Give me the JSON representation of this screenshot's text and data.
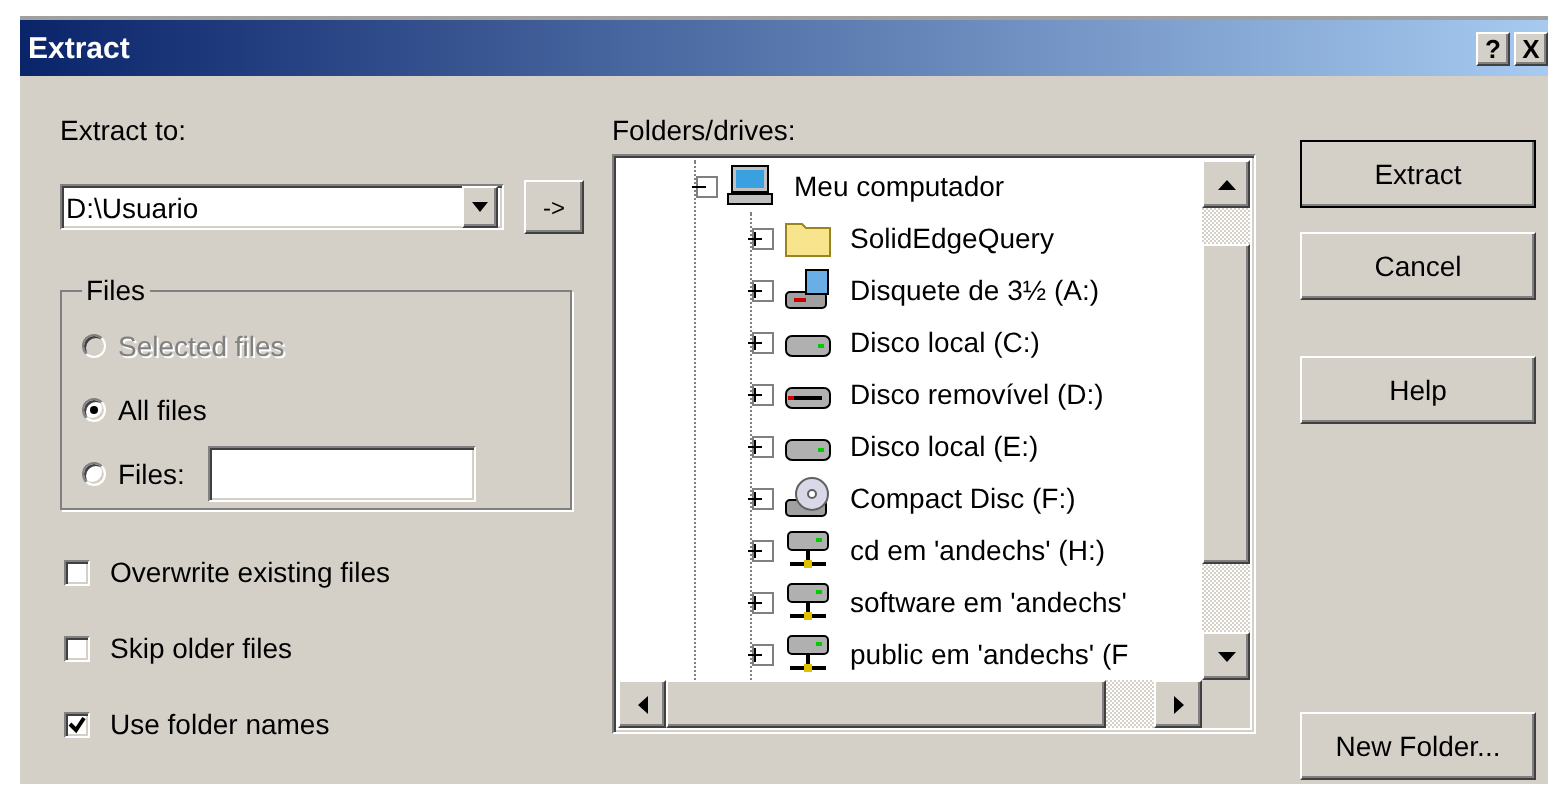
{
  "window": {
    "title": "Extract",
    "title_buttons": [
      "?",
      "X"
    ]
  },
  "extract_to": {
    "label": "Extract to:",
    "value": "D:\\Usuario",
    "arrow_button": "->"
  },
  "files_group": {
    "title": "Files",
    "options": [
      {
        "kind": "radio",
        "label": "Selected files",
        "selected": false,
        "disabled": true
      },
      {
        "kind": "radio",
        "label": "All files",
        "selected": true,
        "disabled": false
      },
      {
        "kind": "radio-field",
        "label": "Files:",
        "selected": false,
        "disabled": false
      }
    ]
  },
  "checkboxes": [
    {
      "label": "Overwrite existing files",
      "checked": false
    },
    {
      "label": "Skip older files",
      "checked": false
    },
    {
      "label": "Use folder names",
      "checked": true
    }
  ],
  "folders": {
    "label": "Folders/drives:",
    "tree": [
      {
        "kind": "computer",
        "label": "Meu computador",
        "expanded": true,
        "children": [
          {
            "kind": "folder",
            "label": "SolidEdgeQuery",
            "expanded": false
          },
          {
            "kind": "floppy",
            "label": "Disquete de 3½ (A:)",
            "expanded": false
          },
          {
            "kind": "drive",
            "label": "Disco local (C:)",
            "expanded": false
          },
          {
            "kind": "removable",
            "label": "Disco removível (D:)",
            "expanded": false
          },
          {
            "kind": "drive",
            "label": "Disco local (E:)",
            "expanded": false
          },
          {
            "kind": "cd",
            "label": "Compact Disc (F:)",
            "expanded": false
          },
          {
            "kind": "network",
            "label": "cd em 'andechs' (H:)",
            "expanded": false
          },
          {
            "kind": "network",
            "label": "software em 'andechs'",
            "expanded": false
          },
          {
            "kind": "network",
            "label": "public em 'andechs' (F",
            "expanded": false
          }
        ]
      }
    ]
  },
  "buttons": [
    {
      "label": "Extract",
      "default": true
    },
    {
      "label": "Cancel",
      "default": false
    },
    {
      "label": "Help",
      "default": false
    }
  ],
  "bottom_button": "New Folder..."
}
